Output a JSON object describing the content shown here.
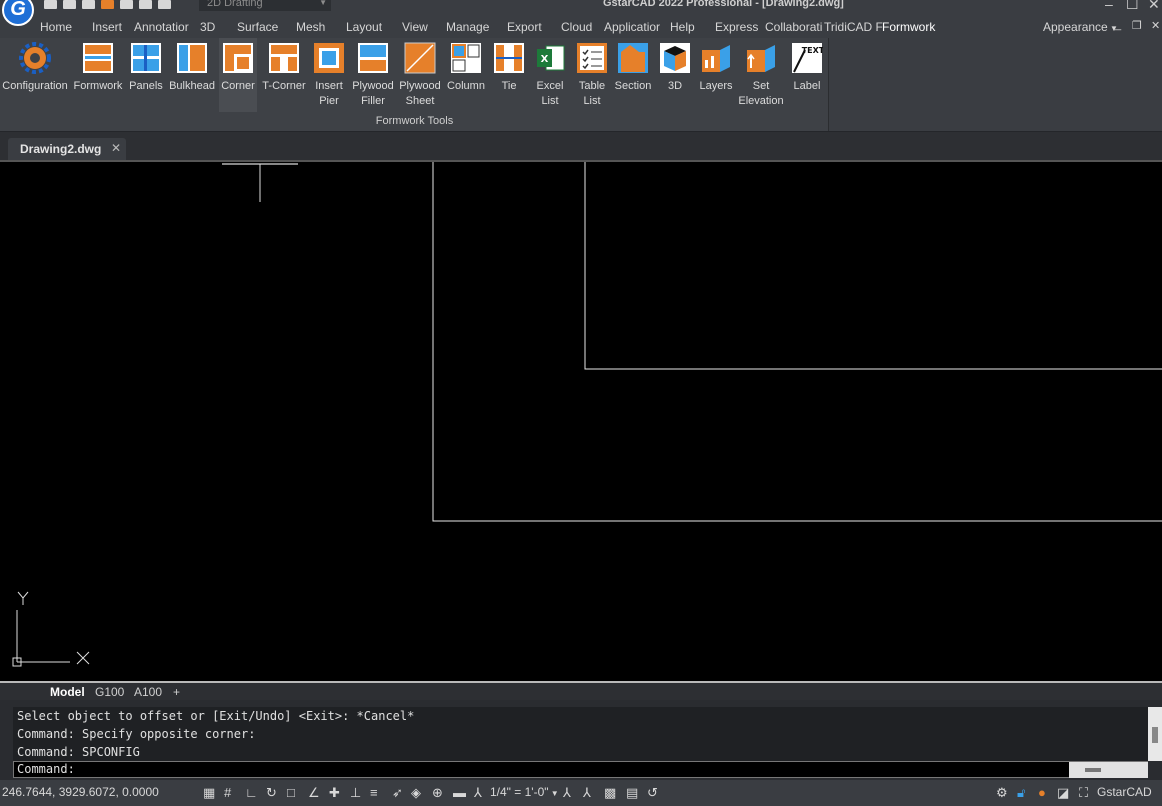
{
  "title_bar": {
    "logo_letter": "G",
    "workspace": "2D Drafting",
    "app_title": "GstarCAD 2022 Professional - [Drawing2.dwg]",
    "window_buttons": [
      "–",
      "☐",
      "✕"
    ]
  },
  "menu_tabs": [
    "Home",
    "Insert",
    "Annotatior",
    "3D",
    "Surface",
    "Mesh",
    "Layout",
    "View",
    "Manage",
    "Export",
    "Cloud",
    "Applicatior",
    "Help",
    "Express",
    "Collaborati",
    "TridiCAD F",
    "Formwork"
  ],
  "active_menu_tab": "Formwork",
  "appearance": "Appearance",
  "ribbon": {
    "panel_title": "Formwork Tools",
    "buttons": [
      {
        "label": "Configuration",
        "icon": "gear-icon"
      },
      {
        "label": "Formwork",
        "icon": "formwork-icon"
      },
      {
        "label": "Panels",
        "icon": "panels-icon"
      },
      {
        "label": "Bulkhead",
        "icon": "bulkhead-icon"
      },
      {
        "label": "Corner",
        "icon": "corner-icon"
      },
      {
        "label": "T-Corner",
        "icon": "t-corner-icon"
      },
      {
        "label": "Insert\nPier",
        "icon": "insert-pier-icon"
      },
      {
        "label": "Plywood\nFiller",
        "icon": "plywood-filler-icon"
      },
      {
        "label": "Plywood\nSheet",
        "icon": "plywood-sheet-icon"
      },
      {
        "label": "Column",
        "icon": "column-icon"
      },
      {
        "label": "Tie",
        "icon": "tie-icon"
      },
      {
        "label": "Excel\nList",
        "icon": "excel-icon"
      },
      {
        "label": "Table\nList",
        "icon": "table-list-icon"
      },
      {
        "label": "Section",
        "icon": "section-icon"
      },
      {
        "label": "3D",
        "icon": "cube-3d-icon"
      },
      {
        "label": "Layers",
        "icon": "layers-icon"
      },
      {
        "label": "Set\nElevation",
        "icon": "set-elevation-icon"
      },
      {
        "label": "Label",
        "icon": "text-label-icon"
      }
    ]
  },
  "document_tab": {
    "name": "Drawing2.dwg",
    "close": "✕"
  },
  "canvas": {
    "ucs_y": "Y",
    "ucs_x": "X"
  },
  "layout_tabs": [
    "Model",
    "G100",
    "A100",
    "+"
  ],
  "command": {
    "history": [
      "Select object to offset or [Exit/Undo] <Exit>: *Cancel*",
      "Command: Specify opposite corner:",
      "Command: SPCONFIG"
    ],
    "prompt": "Command:"
  },
  "status": {
    "coordinates": "246.7644, 3929.6072, 0.0000",
    "scale": "1/4\" = 1'-0\"",
    "app_name": "GstarCAD"
  },
  "colors": {
    "accent_orange": "#e6802a",
    "ribbon_bg": "#3a3d42",
    "canvas_bg": "#000000"
  }
}
